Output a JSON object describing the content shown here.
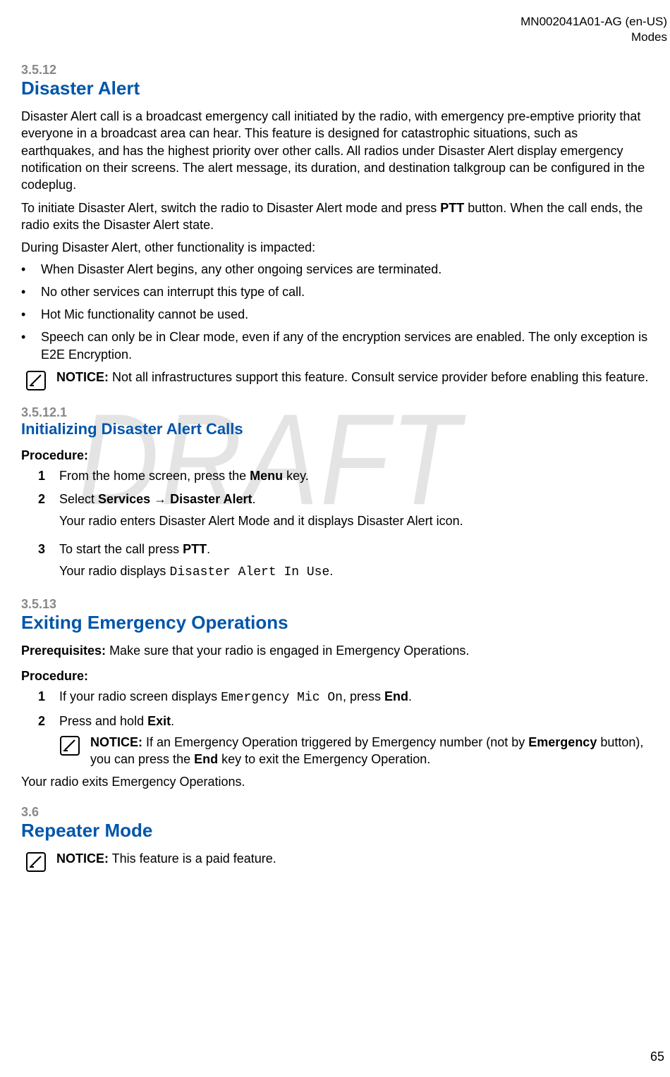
{
  "header": {
    "doc_id": "MN002041A01-AG (en-US)",
    "chapter": "Modes"
  },
  "watermark": "DRAFT",
  "s1": {
    "num": "3.5.12",
    "title": "Disaster Alert",
    "p1": "Disaster Alert call is a broadcast emergency call initiated by the radio, with emergency pre-emptive priority that everyone in a broadcast area can hear. This feature is designed for catastrophic situations, such as earthquakes, and has the highest priority over other calls. All radios under Disaster Alert display emergency notification on their screens. The alert message, its duration, and destination talkgroup can be configured in the codeplug.",
    "p2a": "To initiate Disaster Alert, switch the radio to Disaster Alert mode and press ",
    "p2b": "PTT",
    "p2c": " button. When the call ends, the radio exits the Disaster Alert state.",
    "p3": "During Disaster Alert, other functionality is impacted:",
    "b1": "When Disaster Alert begins, any other ongoing services are terminated.",
    "b2": "No other services can interrupt this type of call.",
    "b3": "Hot Mic functionality cannot be used.",
    "b4": "Speech can only be in Clear mode, even if any of the encryption services are enabled. The only exception is E2E Encryption.",
    "notice_label": "NOTICE:",
    "notice_text": " Not all infrastructures support this feature. Consult service provider before enabling this feature."
  },
  "s2": {
    "num": "3.5.12.1",
    "title": "Initializing Disaster Alert Calls",
    "proc_label": "Procedure:",
    "step1a": "From the home screen, press the ",
    "step1b": "Menu",
    "step1c": " key.",
    "step2a": "Select ",
    "step2b": "Services",
    "step2c": " → ",
    "step2d": "Disaster Alert",
    "step2e": ".",
    "step2_sub": "Your radio enters Disaster Alert Mode and it displays Disaster Alert icon.",
    "step3a": "To start the call press ",
    "step3b": "PTT",
    "step3c": ".",
    "step3_sub_a": "Your radio displays ",
    "step3_sub_b": "Disaster Alert In Use",
    "step3_sub_c": "."
  },
  "s3": {
    "num": "3.5.13",
    "title": "Exiting Emergency Operations",
    "prereq_label": "Prerequisites:",
    "prereq_text": " Make sure that your radio is engaged in Emergency Operations.",
    "proc_label": "Procedure:",
    "step1a": "If your radio screen displays ",
    "step1b": "Emergency Mic On",
    "step1c": ", press ",
    "step1d": "End",
    "step1e": ".",
    "step2a": "Press and hold ",
    "step2b": "Exit",
    "step2c": ".",
    "notice_label": "NOTICE:",
    "notice_a": " If an Emergency Operation triggered by Emergency number (not by ",
    "notice_b": "Emergency",
    "notice_c": " button), you can press the ",
    "notice_d": "End",
    "notice_e": " key to exit the Emergency Operation.",
    "outro": "Your radio exits Emergency Operations."
  },
  "s4": {
    "num": "3.6",
    "title": "Repeater Mode",
    "notice_label": "NOTICE:",
    "notice_text": " This feature is a paid feature."
  },
  "page_number": "65"
}
